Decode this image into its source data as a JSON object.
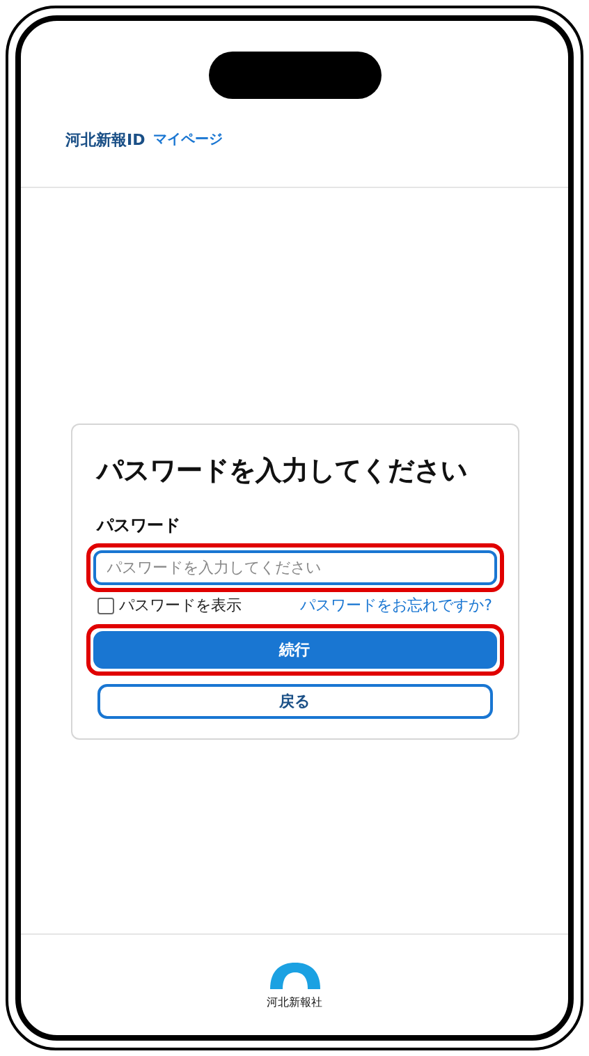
{
  "header": {
    "brand": "河北新報ID",
    "subtitle": "マイページ"
  },
  "card": {
    "title": "パスワードを入力してください",
    "field_label": "パスワード",
    "password": {
      "placeholder": "パスワードを入力してください",
      "highlighted": true
    },
    "show_password": {
      "label": "パスワードを表示",
      "checked": false
    },
    "forgot_link": "パスワードをお忘れですか?",
    "continue_button": {
      "label": "続行",
      "highlighted": true
    },
    "back_button": "戻る"
  },
  "footer": {
    "logo_text": "河北新報社"
  }
}
